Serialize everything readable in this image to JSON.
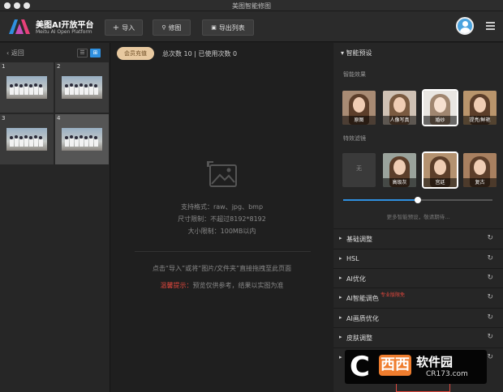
{
  "window": {
    "title": "美图智能修图"
  },
  "toolbar": {
    "logo_title": "美图AI开放平台",
    "logo_subtitle": "Meitu AI Open Platform",
    "import_label": "导入",
    "retouch_label": "修图",
    "export_list_label": "导出列表"
  },
  "left_panel": {
    "back_label": "返回",
    "thumbnails": [
      {
        "num": "1"
      },
      {
        "num": "2"
      },
      {
        "num": "3"
      },
      {
        "num": "4",
        "selected": true
      }
    ]
  },
  "center": {
    "member_button": "会员充值",
    "usage_text": "总次数 10 | 已使用次数 0",
    "supported_formats": "支持格式：raw、jpg、bmp",
    "size_limit": "尺寸限制：不超过8192*8192",
    "file_limit": "大小限制：100MB以内",
    "hint_text": "点击“导入”或将“图片/文件夹”直接拖拽至此页面",
    "tip_label": "温馨提示：",
    "tip_text": "预览仅供参考，结果以实图为准"
  },
  "right_panel": {
    "smart_presets": "智能预设",
    "smart_effects_label": "智能效果",
    "effects": [
      {
        "name": "原图"
      },
      {
        "name": "人像写真"
      },
      {
        "name": "婚纱",
        "selected": true
      },
      {
        "name": "提亮/鲜艳"
      }
    ],
    "filters_label": "特效滤镜",
    "filters": [
      {
        "name": "无"
      },
      {
        "name": "高级灰"
      },
      {
        "name": "宫廷",
        "selected": true
      },
      {
        "name": "复古"
      }
    ],
    "strength": 0.5,
    "more_presets": "更多智能预设，敬请期待...",
    "sections": [
      {
        "label": "基础调整"
      },
      {
        "label": "HSL"
      },
      {
        "label": "AI优化"
      },
      {
        "label": "AI智能调色",
        "tag": "专业版限免"
      },
      {
        "label": "AI画质优化"
      },
      {
        "label": "皮肤调整"
      }
    ]
  },
  "watermark": {
    "name": "软件园",
    "url": "CR173.com",
    "mark": "西西"
  },
  "colors": {
    "accent": "#2f90e0",
    "member": "#e8c9a0",
    "warn": "#e0473d"
  }
}
